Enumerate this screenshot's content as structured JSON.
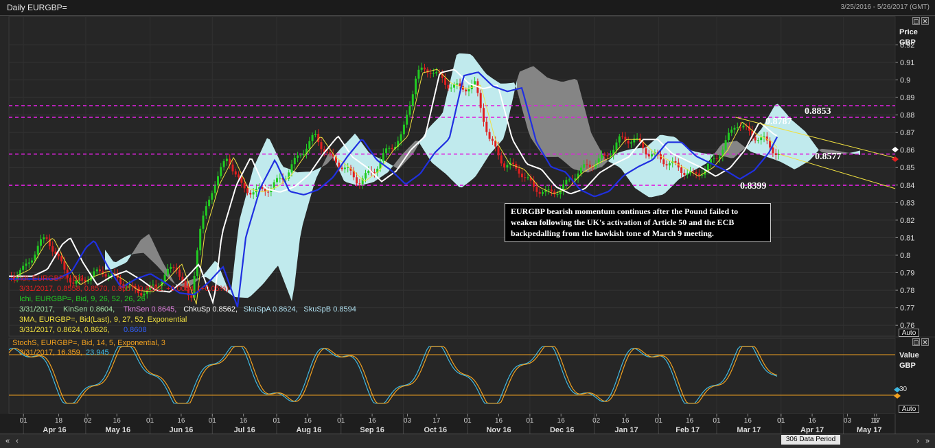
{
  "window": {
    "title": "Daily EURGBP=",
    "date_range": "3/25/2016 - 5/26/2017 (GMT)",
    "data_period": "306 Data Period"
  },
  "annotation": {
    "text": "EURGBP bearish momentum continues after the Pound failed to weaken following the UK's activation of Article 50 and the ECB backpedalling from the hawkish tone of March 9 meeting."
  },
  "price_axis": {
    "title": "Price",
    "unit": "GBP",
    "auto_label": "Auto"
  },
  "stoch_axis": {
    "title": "Value",
    "unit": "GBP",
    "auto_label": "Auto",
    "tick": "30"
  },
  "legend": {
    "cndl_title": "Cndl, EURGBP=, Bid",
    "cndl_values": "3/31/2017, 0.8558, 0.8570, 0.8557, 0.8562, +0.0004, (+0.05%)",
    "ichi_title": "Ichi, EURGBP=, Bid,  9, 26, 52, 26, 26",
    "ichi_values_date": "3/31/2017,",
    "ichi_kinsen": "KinSen 0.8604,",
    "ichi_tknsen": "TknSen 0.8645,",
    "ichi_chkusp": "ChkuSp 0.8562,",
    "ichi_skuspa": "SkuSpA 0.8624,",
    "ichi_skuspb": "SkuSpB 0.8594",
    "ma_title": "3MA, EURGBP=, Bid(Last),  9, 27, 52, Exponential",
    "ma_values": "3/31/2017, 0.8624, 0.8626,",
    "ma_value3": "0.8608",
    "stoch_title": "StochS, EURGBP=, Bid,  14, 5, Exponential, 3",
    "stoch_values": "3/31/2017, 16.359,",
    "stoch_value2": "23.945"
  },
  "colors": {
    "support_line": "#e020e0",
    "cloud_bull": "#c8f4f8",
    "cloud_bear": "#8a8a8a",
    "ma_fast": "#f0e040",
    "ma_mid": "#ffffff",
    "ma_slow": "#2030e0",
    "candle_up": "#22cc22",
    "candle_down": "#e02020",
    "stoch_k": "#f0a020",
    "stoch_d": "#40b8e0",
    "trend_line": "#f0e040"
  },
  "chart_data": {
    "type": "line",
    "price_ticks": [
      "0.92",
      "0.91",
      "0.9",
      "0.89",
      "0.88",
      "0.87",
      "0.86",
      "0.85",
      "0.84",
      "0.83",
      "0.82",
      "0.81",
      "0.8",
      "0.79",
      "0.78",
      "0.77",
      "0.76"
    ],
    "ylim": [
      0.7538,
      0.9362
    ],
    "horizontal_levels": [
      {
        "value": 0.8853,
        "label": "0.8853"
      },
      {
        "value": 0.8787,
        "label": "0.8787"
      },
      {
        "value": 0.8577,
        "label": "0.8577"
      },
      {
        "value": 0.8399,
        "label": "0.8399"
      }
    ],
    "x_day_labels": [
      "01",
      "18",
      "02",
      "16",
      "01",
      "16",
      "01",
      "16",
      "01",
      "16",
      "01",
      "16",
      "03",
      "17",
      "01",
      "16",
      "01",
      "16",
      "02",
      "16",
      "01",
      "16",
      "01",
      "16",
      "01",
      "16",
      "03",
      "17",
      "01",
      "16"
    ],
    "x_month_labels": [
      "Apr 16",
      "May 16",
      "Jun 16",
      "Jul 16",
      "Aug 16",
      "Sep 16",
      "Oct 16",
      "Nov 16",
      "Dec 16",
      "Jan 17",
      "Feb 17",
      "Mar 17",
      "Apr 17",
      "May 17"
    ],
    "price_close": [
      [
        "2016-03-25",
        0.788
      ],
      [
        "2016-04-01",
        0.792
      ],
      [
        "2016-04-08",
        0.806
      ],
      [
        "2016-04-12",
        0.81
      ],
      [
        "2016-04-18",
        0.796
      ],
      [
        "2016-04-25",
        0.783
      ],
      [
        "2016-05-02",
        0.788
      ],
      [
        "2016-05-09",
        0.791
      ],
      [
        "2016-05-16",
        0.786
      ],
      [
        "2016-05-23",
        0.78
      ],
      [
        "2016-05-30",
        0.779
      ],
      [
        "2016-06-06",
        0.786
      ],
      [
        "2016-06-13",
        0.795
      ],
      [
        "2016-06-20",
        0.772
      ],
      [
        "2016-06-24",
        0.812
      ],
      [
        "2016-07-01",
        0.84
      ],
      [
        "2016-07-08",
        0.856
      ],
      [
        "2016-07-15",
        0.838
      ],
      [
        "2016-07-22",
        0.836
      ],
      [
        "2016-07-29",
        0.839
      ],
      [
        "2016-08-05",
        0.846
      ],
      [
        "2016-08-12",
        0.858
      ],
      [
        "2016-08-19",
        0.868
      ],
      [
        "2016-08-26",
        0.856
      ],
      [
        "2016-09-02",
        0.85
      ],
      [
        "2016-09-09",
        0.842
      ],
      [
        "2016-09-16",
        0.848
      ],
      [
        "2016-09-23",
        0.86
      ],
      [
        "2016-09-30",
        0.868
      ],
      [
        "2016-10-07",
        0.904
      ],
      [
        "2016-10-14",
        0.906
      ],
      [
        "2016-10-21",
        0.898
      ],
      [
        "2016-10-28",
        0.895
      ],
      [
        "2016-11-04",
        0.897
      ],
      [
        "2016-11-11",
        0.866
      ],
      [
        "2016-11-18",
        0.852
      ],
      [
        "2016-11-25",
        0.849
      ],
      [
        "2016-12-02",
        0.839
      ],
      [
        "2016-12-09",
        0.835
      ],
      [
        "2016-12-16",
        0.838
      ],
      [
        "2016-12-23",
        0.847
      ],
      [
        "2016-12-30",
        0.852
      ],
      [
        "2017-01-06",
        0.856
      ],
      [
        "2017-01-13",
        0.866
      ],
      [
        "2017-01-20",
        0.866
      ],
      [
        "2017-01-27",
        0.858
      ],
      [
        "2017-02-03",
        0.854
      ],
      [
        "2017-02-10",
        0.85
      ],
      [
        "2017-02-17",
        0.845
      ],
      [
        "2017-02-24",
        0.85
      ],
      [
        "2017-03-03",
        0.86
      ],
      [
        "2017-03-10",
        0.876
      ],
      [
        "2017-03-17",
        0.869
      ],
      [
        "2017-03-24",
        0.865
      ],
      [
        "2017-03-31",
        0.8562
      ]
    ],
    "trend_lines": [
      {
        "from": [
          "2017-03-10",
          0.8787
        ],
        "to": [
          "2017-05-26",
          0.8555
        ]
      },
      {
        "from": [
          "2017-03-31",
          0.8577
        ],
        "to": [
          "2017-05-26",
          0.838
        ]
      }
    ],
    "stoch_range": [
      0,
      100
    ],
    "stoch_levels": [
      80,
      20
    ],
    "stoch_k_last": 16.359,
    "stoch_d_last": 23.945
  }
}
